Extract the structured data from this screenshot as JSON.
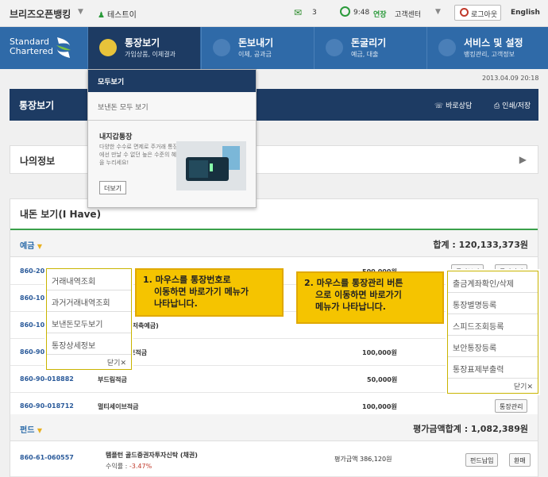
{
  "topbar": {
    "brand": "브리즈오픈뱅킹",
    "user": "테스트이",
    "mail_count": "3",
    "time": "9:48",
    "extend": "연장",
    "customer_center": "고객센터",
    "logout": "로그아웃",
    "lang": "English"
  },
  "logo": {
    "line1": "Standard",
    "line2": "Chartered"
  },
  "nav": [
    {
      "label": "통장보기",
      "sub": "가입상품, 이체결과"
    },
    {
      "label": "돈보내기",
      "sub": "이체, 공과금"
    },
    {
      "label": "돈굴리기",
      "sub": "예금, 대출"
    },
    {
      "label": "서비스 및 설정",
      "sub": "뱅킹관리, 고객정보"
    }
  ],
  "date": "2013.04.09 20:18",
  "page_title": "통장보기",
  "page_actions": {
    "consult": "바로상담",
    "print": "인쇄/저장"
  },
  "mega": {
    "header": "모두보기",
    "item1": "보낸돈 모두 보기",
    "promo_title": "내지갑통장",
    "promo_desc": "다양한 수수료 면제로 주거래 통장에선 만날 수 없던 높은 수준의 혜택을 누리세요!",
    "more": "더보기"
  },
  "myinfo": "나의정보",
  "main": {
    "title": "내돈 보기(I Have)",
    "deposit": {
      "label": "예금",
      "total": "합계 : 120,133,373원"
    },
    "rows": [
      {
        "acct": "860-20-",
        "amt": "500,000원",
        "btn1": "통장보기",
        "btn2": "통장관리"
      },
      {
        "acct": "860-10-",
        "amt": "",
        "btn1": "",
        "btn2": ""
      },
      {
        "acct": "860-10-",
        "name": "(저축예금)",
        "amt": ""
      },
      {
        "acct": "860-90-",
        "name": "브적금",
        "amt": "100,000원"
      },
      {
        "acct": "860-90-018882",
        "name": "부드림적금",
        "amt": "50,000원"
      },
      {
        "acct": "860-90-018712",
        "name": "멀티세이브적금",
        "amt": "100,000원",
        "btn2": "통장관리"
      }
    ],
    "fund": {
      "label": "펀드",
      "total": "평가금액합계 : 1,082,389원"
    },
    "fund_row": {
      "acct": "860-61-060557",
      "name": "템플턴  골드증권자투자신탁 (채권)",
      "yield_label": "수익률 : ",
      "yield": "-3.47%",
      "amt": "평가금액  386,120원",
      "btn1": "펀드납입",
      "btn2": "환매"
    }
  },
  "ctx1": {
    "items": [
      "거래내역조회",
      "과거거래내역조회",
      "보낸돈모두보기",
      "통장상세정보"
    ],
    "close": "닫기✕"
  },
  "ctx2": {
    "items": [
      "출금계좌확인/삭제",
      "통장별명등록",
      "스피드조회등록",
      "보안통장등록",
      "통장표제부출력"
    ],
    "close": "닫기✕"
  },
  "callout1": [
    "1. 마우스를 통장번호로",
    "이동하면 바로가기 메뉴가",
    "나타납니다."
  ],
  "callout2": [
    "2. 마우스를 통장관리 버튼",
    "으로 이동하면 바로가기",
    "메뉴가 나타납니다."
  ]
}
